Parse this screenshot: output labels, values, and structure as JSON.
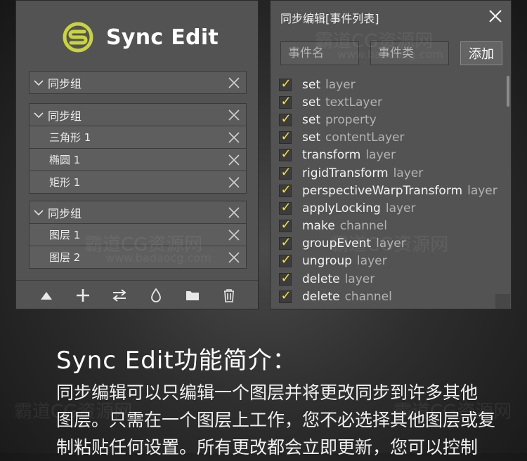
{
  "app": {
    "logo_text": "Sync Edit"
  },
  "groups": [
    {
      "title": "同步组",
      "items": []
    },
    {
      "title": "同步组",
      "items": [
        "三角形 1",
        "椭圆 1",
        "矩形 1"
      ]
    },
    {
      "title": "同步组",
      "items": [
        "图层 1",
        "图层 2"
      ]
    }
  ],
  "toolbar": {
    "icons": [
      "triangle-up-icon",
      "plus-icon",
      "swap-icon",
      "drop-icon",
      "folder-icon",
      "trash-icon"
    ]
  },
  "event_panel": {
    "title": "同步编辑[事件列表]",
    "event_name_placeholder": "事件名",
    "event_type_placeholder": "事件类",
    "add_label": "添加",
    "events": [
      {
        "checked": true,
        "name": "set",
        "type": "layer"
      },
      {
        "checked": true,
        "name": "set",
        "type": "textLayer"
      },
      {
        "checked": true,
        "name": "set",
        "type": "property"
      },
      {
        "checked": true,
        "name": "set",
        "type": "contentLayer"
      },
      {
        "checked": true,
        "name": "transform",
        "type": "layer"
      },
      {
        "checked": true,
        "name": "rigidTransform",
        "type": "layer"
      },
      {
        "checked": true,
        "name": "perspectiveWarpTransform",
        "type": "layer"
      },
      {
        "checked": true,
        "name": "applyLocking",
        "type": "layer"
      },
      {
        "checked": true,
        "name": "make",
        "type": "channel"
      },
      {
        "checked": true,
        "name": "groupEvent",
        "type": "layer"
      },
      {
        "checked": true,
        "name": "ungroup",
        "type": "layer"
      },
      {
        "checked": true,
        "name": "delete",
        "type": "layer"
      },
      {
        "checked": true,
        "name": "delete",
        "type": "channel"
      }
    ]
  },
  "intro": {
    "title": "Sync Edit功能简介：",
    "lines": [
      "同步编辑可以只编辑一个图层并将更改同步到许多其他",
      "图层。只需在一个图层上工作，您不必选择其他图层或复",
      "制粘贴任何设置。所有更改都会立即更新，您可以控制"
    ]
  },
  "colors": {
    "logo_accent": "#c9d341",
    "check": "#f6e33b"
  },
  "watermark": {
    "site_name": "霸道CG资源网",
    "site_url": "www.badaocg.com"
  }
}
